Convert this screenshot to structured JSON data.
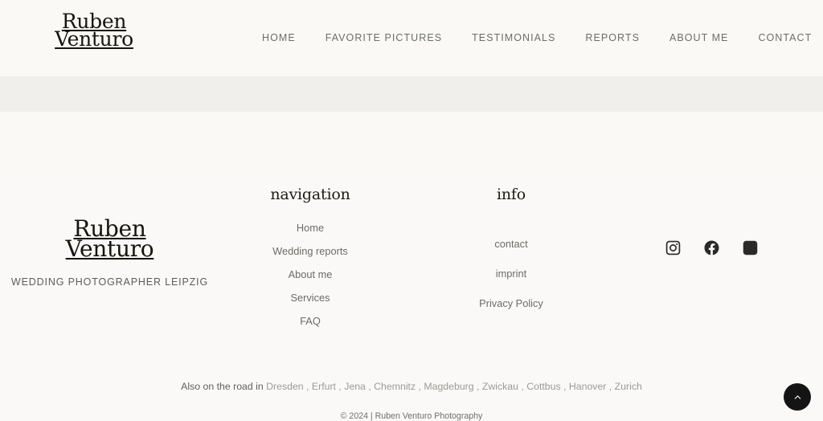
{
  "header": {
    "brand": {
      "line1": "Ruben",
      "line2": "Venturo"
    },
    "nav": [
      {
        "label": "HOME",
        "name": "nav-home"
      },
      {
        "label": "FAVORITE PICTURES",
        "name": "nav-favorite-pictures"
      },
      {
        "label": "TESTIMONIALS",
        "name": "nav-testimonials"
      },
      {
        "label": "REPORTS",
        "name": "nav-reports"
      },
      {
        "label": "ABOUT ME",
        "name": "nav-about-me"
      },
      {
        "label": "CONTACT",
        "name": "nav-contact"
      }
    ]
  },
  "footer": {
    "brand": {
      "line1": "Ruben",
      "line2": "Venturo"
    },
    "tagline": "WEDDING PHOTOGRAPHER LEIPZIG",
    "navigation": {
      "heading": "navigation",
      "links": [
        {
          "label": "Home"
        },
        {
          "label": "Wedding reports"
        },
        {
          "label": "About me"
        },
        {
          "label": "Services"
        },
        {
          "label": "FAQ"
        }
      ]
    },
    "info": {
      "heading": "info",
      "links": [
        {
          "label": "contact"
        },
        {
          "label": "imprint"
        },
        {
          "label": "Privacy Policy"
        }
      ]
    },
    "social": [
      {
        "name": "instagram-icon",
        "label": "Instagram"
      },
      {
        "name": "facebook-icon",
        "label": "Facebook"
      },
      {
        "name": "pinterest-icon",
        "label": "Pinterest"
      }
    ],
    "road": {
      "lead": "Also on the road in",
      "cities": [
        "Dresden",
        "Erfurt",
        "Jena",
        "Chemnitz",
        "Magdeburg",
        "Zwickau",
        "Cottbus",
        "Hanover",
        "Zurich"
      ],
      "separator": ","
    },
    "copyright": "© 2024 | Ruben Venturo Photography"
  },
  "controls": {
    "back_to_top": "Back to top"
  },
  "colors": {
    "page_bg": "#faf9f6",
    "band_bg": "#f0efeb",
    "footer_bg": "#faf9f7",
    "text_dark": "#16150f",
    "text_muted": "#6b6b67",
    "accent_dark": "#141414"
  }
}
